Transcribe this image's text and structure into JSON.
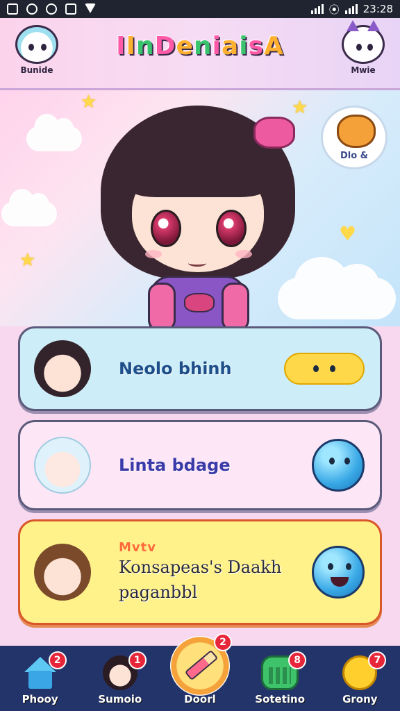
{
  "status_bar": {
    "time": "23:28"
  },
  "header": {
    "title": "IInDeniaisA",
    "left_avatar_label": "Bunide",
    "right_avatar_label": "Mwie"
  },
  "hero": {
    "notification_label": "Dlo &"
  },
  "cards": [
    {
      "title": "Neolo bhinh"
    },
    {
      "title": "Linta bdage"
    },
    {
      "subtitle": "Mvtv",
      "title_line1": "Konsapeas's Daakh",
      "title_line2": "paganbbl"
    }
  ],
  "bottom_nav": [
    {
      "label": "Phooy",
      "badge": "2",
      "icon": "home-icon"
    },
    {
      "label": "Sumoio",
      "badge": "1",
      "icon": "face-icon"
    },
    {
      "label": "Doorl",
      "badge": "2",
      "icon": "pencil-icon",
      "active": true
    },
    {
      "label": "Sotetino",
      "badge": "8",
      "icon": "calendar-icon"
    },
    {
      "label": "Grony",
      "badge": "7",
      "icon": "duck-icon"
    }
  ],
  "colors": {
    "nav_bg": "#23346a",
    "badge": "#e8263a",
    "card1": "#cdeef8",
    "card2": "#fde7f6",
    "card3": "#fff28a"
  }
}
